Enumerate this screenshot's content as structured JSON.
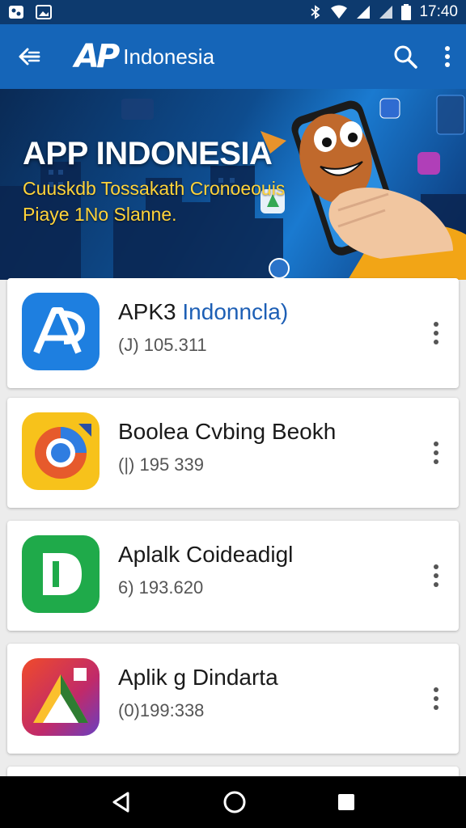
{
  "status_bar": {
    "time": "17:40",
    "icons": [
      "gallery-icon",
      "image-icon",
      "bluetooth-icon",
      "wifi-icon",
      "signal-icon",
      "signal-icon",
      "battery-icon"
    ]
  },
  "app_bar": {
    "logo_text": "AP",
    "title": "Indonesia",
    "icons": [
      "back-arrow-icon",
      "search-icon",
      "more-vert-icon"
    ]
  },
  "banner": {
    "heading": "APP INDONESIA",
    "subtitle_line1": "Cuuskdb Tossakath Cronoeouis",
    "subtitle_line2": "Piaye 1No Slanne."
  },
  "apps": [
    {
      "name": "APK3",
      "name_accent": " Indonncla)",
      "meta": "(J) 105.311",
      "icon": "apk-blue-icon"
    },
    {
      "name": "Boolea Cvbing Beokh",
      "name_accent": "",
      "meta": "(|) 195 339",
      "icon": "yellow-circle-icon"
    },
    {
      "name": "Aplalk Coideadigl",
      "name_accent": "",
      "meta": "6) 193.620",
      "icon": "green-d-icon"
    },
    {
      "name": "Aplik g Dindarta",
      "name_accent": "",
      "meta": "(0)199:338",
      "icon": "triangle-icon"
    }
  ],
  "nav_bar": {
    "icons": [
      "back-triangle-icon",
      "home-circle-icon",
      "recents-square-icon"
    ]
  },
  "colors": {
    "status_bar": "#0d3a6e",
    "app_bar": "#1565b8",
    "banner_yellow": "#ffd33a",
    "accent_blue": "#1d5fb5"
  }
}
